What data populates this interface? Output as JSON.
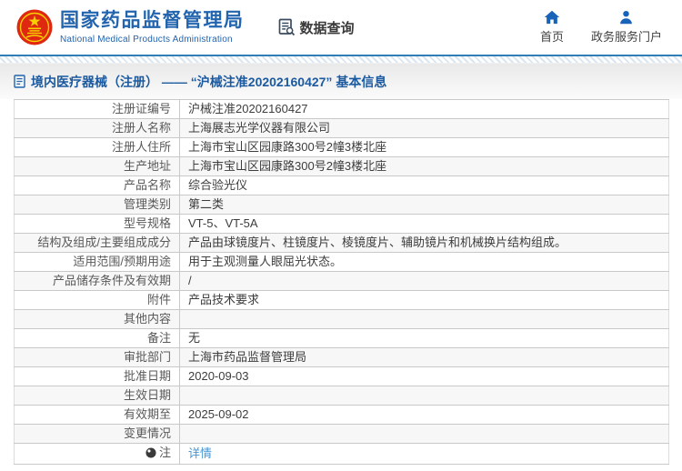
{
  "header": {
    "logo_icon": "national-emblem-icon",
    "org_name_cn": "国家药品监督管理局",
    "org_name_en": "National Medical Products Administration",
    "data_query": {
      "icon": "doc-search-icon",
      "label": "数据查询"
    },
    "nav": [
      {
        "icon": "home-icon",
        "label": "首页"
      },
      {
        "icon": "user-icon",
        "label": "政务服务门户"
      }
    ]
  },
  "breadcrumb": {
    "icon": "document-icon",
    "text": "境内医疗器械（注册） —— “沪械注准20202160427” 基本信息"
  },
  "detail_table": {
    "rows": [
      {
        "label": "注册证编号",
        "value": "沪械注准20202160427"
      },
      {
        "label": "注册人名称",
        "value": "上海展志光学仪器有限公司"
      },
      {
        "label": "注册人住所",
        "value": "上海市宝山区园康路300号2幢3楼北座"
      },
      {
        "label": "生产地址",
        "value": "上海市宝山区园康路300号2幢3楼北座"
      },
      {
        "label": "产品名称",
        "value": "综合验光仪"
      },
      {
        "label": "管理类别",
        "value": "第二类"
      },
      {
        "label": "型号规格",
        "value": "VT-5、VT-5A"
      },
      {
        "label": "结构及组成/主要组成成分",
        "value": "产品由球镜度片、柱镜度片、棱镜度片、辅助镜片和机械换片结构组成。"
      },
      {
        "label": "适用范围/预期用途",
        "value": "用于主观测量人眼屈光状态。"
      },
      {
        "label": "产品储存条件及有效期",
        "value": "/"
      },
      {
        "label": "附件",
        "value": "产品技术要求"
      },
      {
        "label": "其他内容",
        "value": ""
      },
      {
        "label": "备注",
        "value": "无"
      },
      {
        "label": "审批部门",
        "value": "上海市药品监督管理局"
      },
      {
        "label": "批准日期",
        "value": "2020-09-03"
      },
      {
        "label": "生效日期",
        "value": ""
      },
      {
        "label": "有效期至",
        "value": "2025-09-02"
      },
      {
        "label": "变更情况",
        "value": ""
      },
      {
        "label": "注",
        "value": "详情",
        "icon": "note-icon",
        "value_is_link": true
      }
    ]
  },
  "colors": {
    "brand_blue": "#2264ae",
    "breadcrumb_blue": "#1c5aa0",
    "top_line_blue": "#2f7fb6",
    "nav_icon_blue": "#1863b8",
    "link_blue": "#4596d3",
    "row_stripe": "#f7f7f7",
    "table_border": "#c9c9c9",
    "emblem_red": "#de2910",
    "emblem_gold": "#f8d000"
  }
}
